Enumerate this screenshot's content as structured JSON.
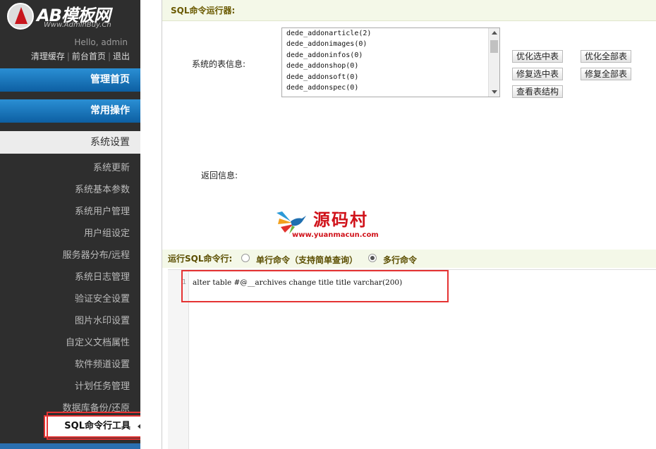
{
  "logo": {
    "brand": "AB模板网",
    "site": "Www.AdminBuy.Cn"
  },
  "user": {
    "greeting": "Hello, admin",
    "links": [
      "清理缓存",
      "前台首页",
      "退出"
    ]
  },
  "nav": {
    "main_home": "管理首页",
    "common_ops": "常用操作",
    "system_settings": "系统设置",
    "items": [
      "系统更新",
      "系统基本参数",
      "系统用户管理",
      "用户组设定",
      "服务器分布/远程",
      "系统日志管理",
      "验证安全设置",
      "图片水印设置",
      "自定义文档属性",
      "软件频道设置",
      "计划任务管理",
      "数据库备份/还原"
    ],
    "active": "SQL命令行工具"
  },
  "panel": {
    "title": "SQL命令运行器:",
    "table_info_label": "系统的表信息:",
    "tables": [
      "dede_addonarticle(2)",
      "dede_addonimages(0)",
      "dede_addoninfos(0)",
      "dede_addonshop(0)",
      "dede_addonsoft(0)",
      "dede_addonspec(0)"
    ],
    "buttons": {
      "optimize_selected": "优化选中表",
      "optimize_all": "优化全部表",
      "repair_selected": "修复选中表",
      "repair_all": "修复全部表",
      "view_structure": "查看表结构"
    },
    "return_label": "返回信息:"
  },
  "watermark": {
    "cn": "源码村",
    "en": "www.yuanmacun.com"
  },
  "sql": {
    "run_label": "运行SQL命令行:",
    "mode_single": "单行命令（支持简单查询）",
    "mode_multi": "多行命令",
    "selected_mode": "multi",
    "line_number": "1",
    "code": "alter table #@__archives change title title varchar(200)"
  }
}
